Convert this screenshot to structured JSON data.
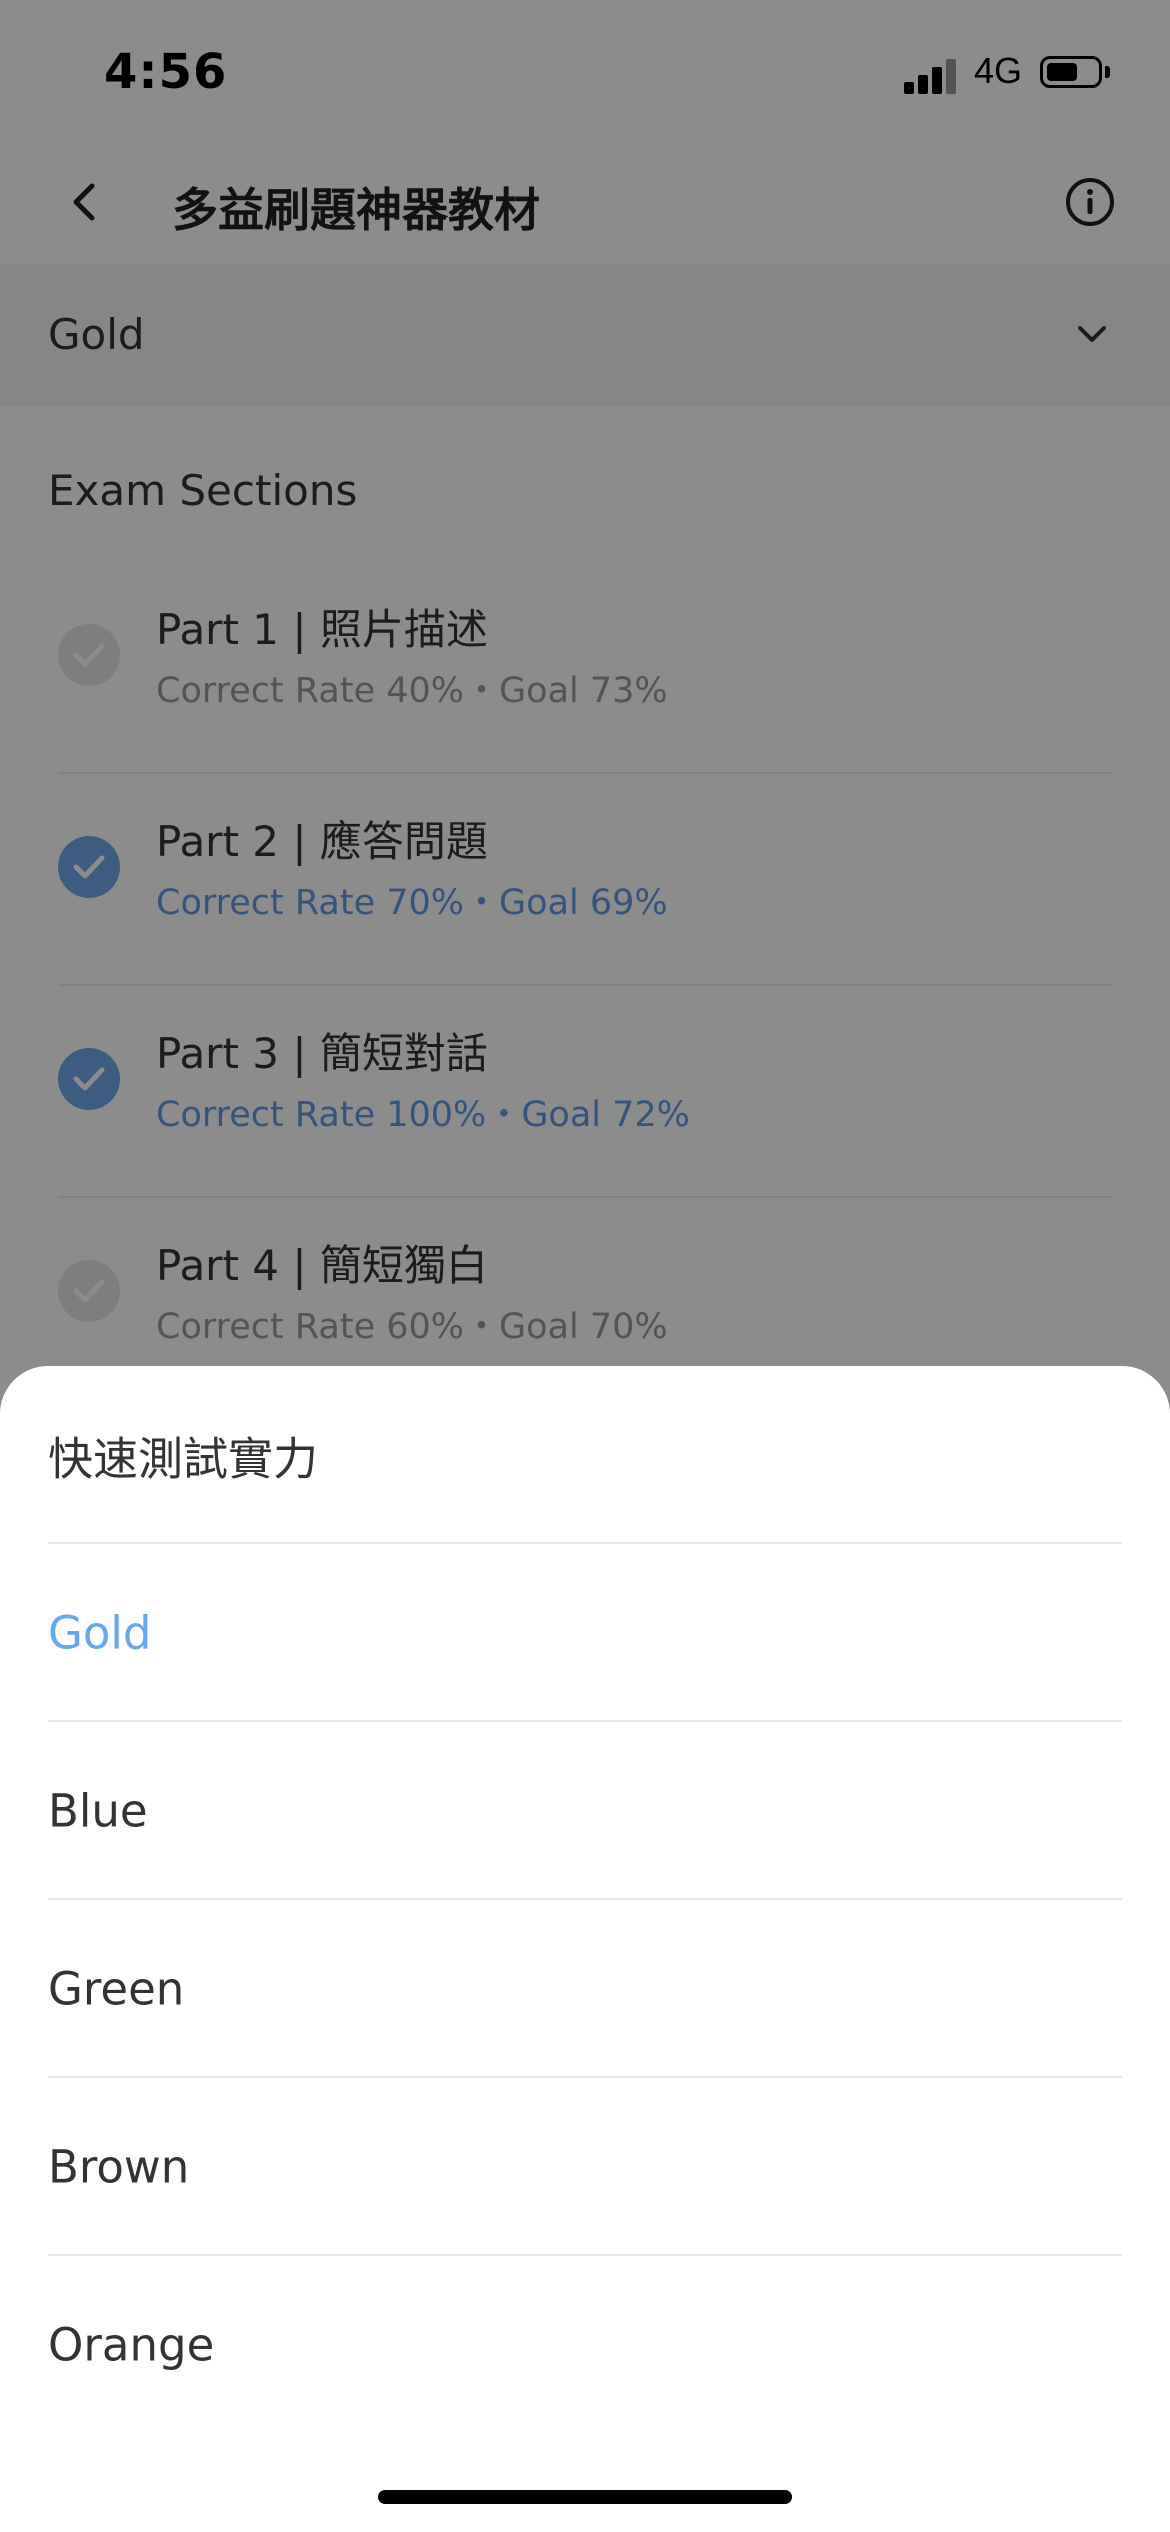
{
  "status_bar": {
    "time": "4:56",
    "network": "4G",
    "battery_level": 0.6
  },
  "nav": {
    "title": "多益刷題神器教材",
    "back_icon": "chevron-left-icon",
    "info_icon": "info-icon"
  },
  "level_select": {
    "value": "Gold"
  },
  "sections": {
    "title": "Exam Sections",
    "items": [
      {
        "title": "Part 1 | 照片描述",
        "subtitle": "Correct Rate 40%・Goal 73%",
        "achieved": false
      },
      {
        "title": "Part 2 | 應答問題",
        "subtitle": "Correct Rate 70%・Goal 69%",
        "achieved": true
      },
      {
        "title": "Part 3 | 簡短對話",
        "subtitle": "Correct Rate 100%・Goal 72%",
        "achieved": true
      },
      {
        "title": "Part 4 | 簡短獨白",
        "subtitle": "Correct Rate 60%・Goal 70%",
        "achieved": false
      }
    ]
  },
  "sheet": {
    "options": [
      "快速測試實力",
      "Gold",
      "Blue",
      "Green",
      "Brown",
      "Orange"
    ],
    "selected": "Gold"
  },
  "colors": {
    "accent": "#63a8f0",
    "achieved_check": "#6fa8ec",
    "overlay": "rgba(0,0,0,0.45)"
  }
}
